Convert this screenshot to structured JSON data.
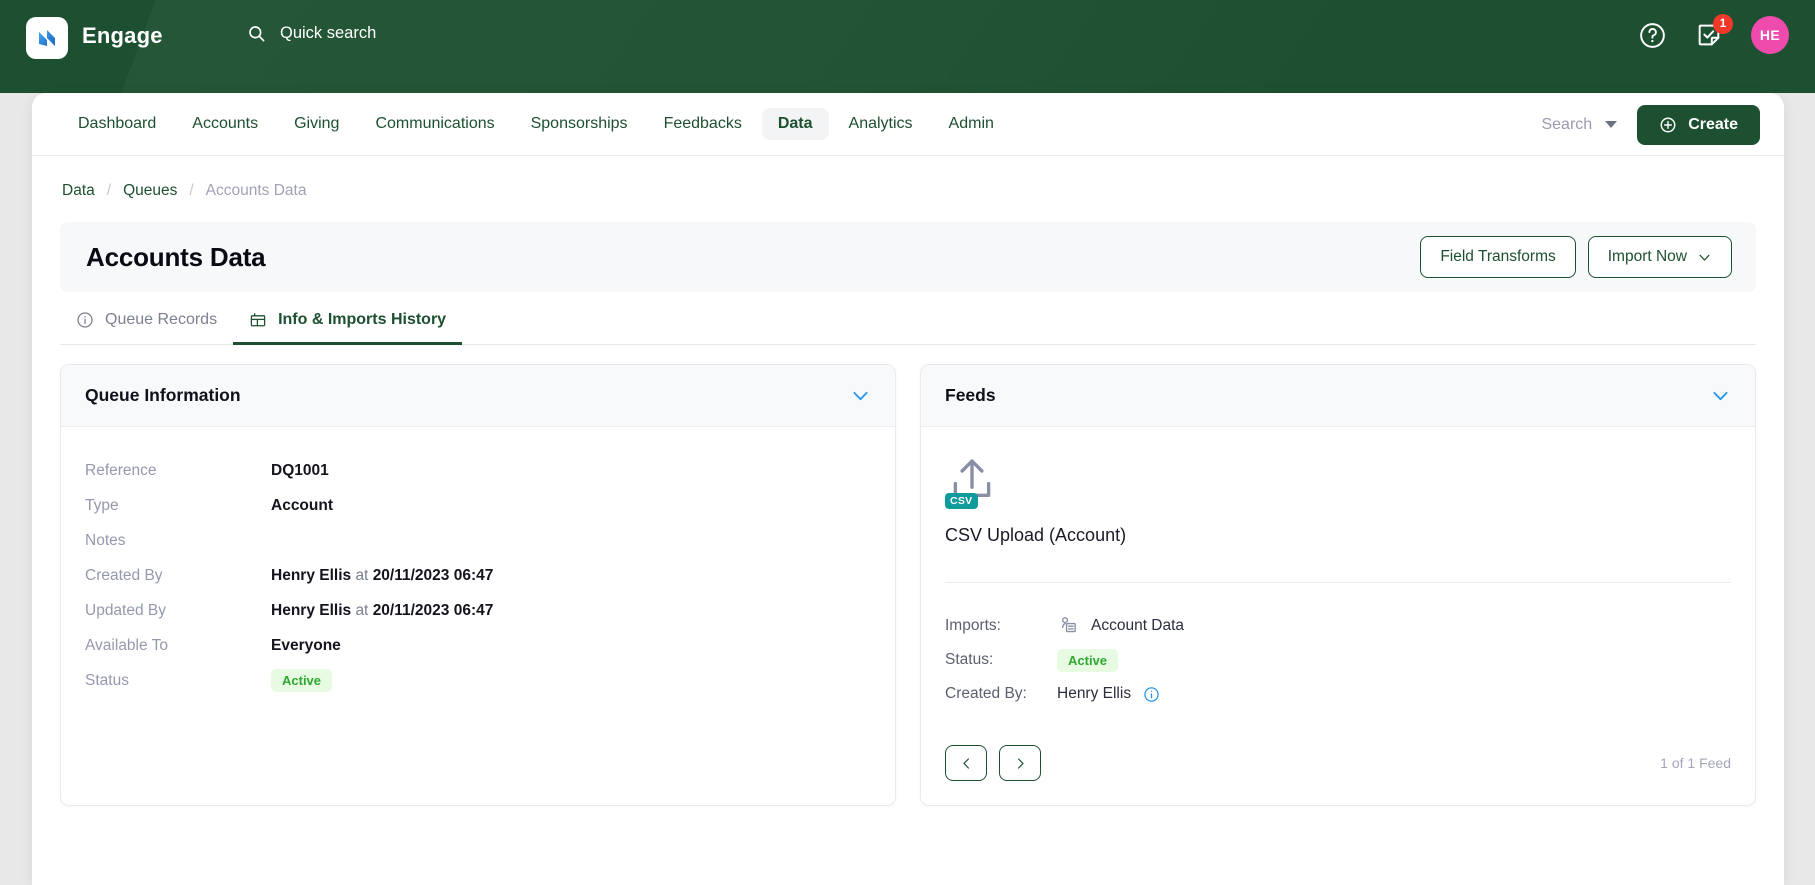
{
  "header": {
    "brand": "Engage",
    "logo_icon": "engage-logo-icon",
    "search_icon": "search-icon",
    "quick_search_label": "Quick search",
    "help_icon": "help-circle-icon",
    "tasks_icon": "task-check-icon",
    "tasks_badge": "1",
    "avatar_initials": "HE",
    "brand_color": "#1d5030",
    "badge_color": "#f0392b",
    "avatar_color": "#ef4bad"
  },
  "nav": {
    "items": [
      {
        "label": "Dashboard",
        "active": false
      },
      {
        "label": "Accounts",
        "active": false
      },
      {
        "label": "Giving",
        "active": false
      },
      {
        "label": "Communications",
        "active": false
      },
      {
        "label": "Sponsorships",
        "active": false
      },
      {
        "label": "Feedbacks",
        "active": false
      },
      {
        "label": "Data",
        "active": true
      },
      {
        "label": "Analytics",
        "active": false
      },
      {
        "label": "Admin",
        "active": false
      }
    ],
    "search_label": "Search",
    "search_caret_icon": "caret-down-icon",
    "create_label": "Create",
    "create_icon": "plus-circle-icon"
  },
  "breadcrumb": {
    "items": [
      {
        "label": "Data",
        "current": false
      },
      {
        "label": "Queues",
        "current": false
      },
      {
        "label": "Accounts Data",
        "current": true
      }
    ],
    "separator": "/"
  },
  "titlebar": {
    "title": "Accounts Data",
    "field_transforms_label": "Field Transforms",
    "import_now_label": "Import Now",
    "import_now_caret_icon": "chevron-down-icon"
  },
  "tabs": [
    {
      "label": "Queue Records",
      "icon": "info-circle-icon",
      "active": false
    },
    {
      "label": "Info & Imports History",
      "icon": "table-grid-icon",
      "active": true
    }
  ],
  "queue_information": {
    "panel_title": "Queue Information",
    "collapse_icon": "chevron-down-icon",
    "rows": [
      {
        "label": "Reference",
        "value": "DQ1001",
        "type": "text"
      },
      {
        "label": "Type",
        "value": "Account",
        "type": "text"
      },
      {
        "label": "Notes",
        "value": "",
        "type": "text"
      },
      {
        "label": "Created By",
        "value": "Henry Ellis",
        "connector": "at",
        "value2": "20/11/2023 06:47",
        "type": "user-date"
      },
      {
        "label": "Updated By",
        "value": "Henry Ellis",
        "connector": "at",
        "value2": "20/11/2023 06:47",
        "type": "user-date"
      },
      {
        "label": "Available To",
        "value": "Everyone",
        "type": "text"
      },
      {
        "label": "Status",
        "value": "Active",
        "type": "badge"
      }
    ]
  },
  "feeds": {
    "panel_title": "Feeds",
    "collapse_icon": "chevron-down-icon",
    "feed_icon": "csv-upload-icon",
    "feed_badge_text": "CSV",
    "feed_badge_color": "#109c9c",
    "feed_name": "CSV Upload (Account)",
    "rows": [
      {
        "label": "Imports:",
        "value": "Account Data",
        "icon": "account-card-icon"
      },
      {
        "label": "Status:",
        "value": "Active",
        "type": "badge"
      },
      {
        "label": "Created By:",
        "value": "Henry Ellis",
        "icon": "info-circle-icon"
      }
    ],
    "prev_icon": "chevron-left-icon",
    "next_icon": "chevron-right-icon",
    "count_text": "1 of 1 Feed"
  },
  "colors": {
    "status_active_text": "#2fa832",
    "status_active_bg": "#e7fbe2",
    "chevron_blue": "#2b95e8"
  }
}
